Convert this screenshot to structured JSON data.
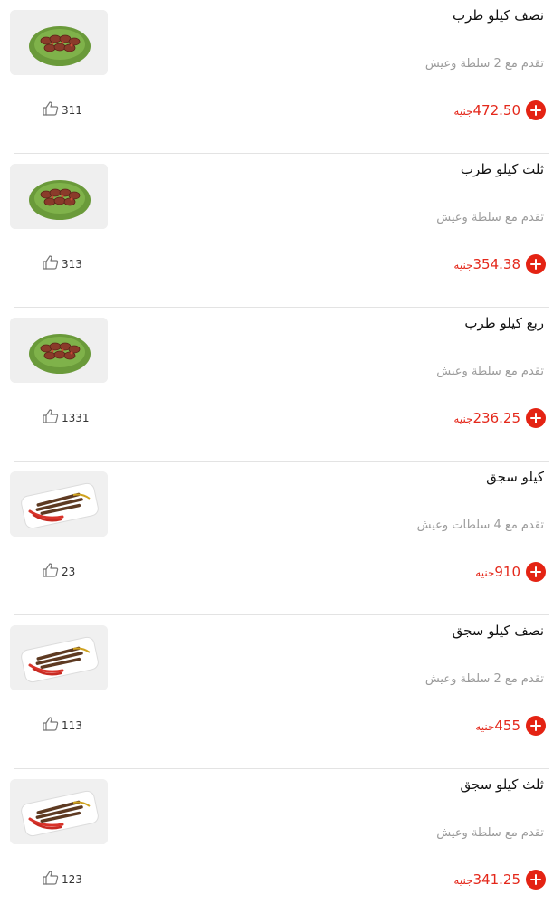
{
  "currency": "جنيه",
  "items": [
    {
      "name": "نصف كيلو طرب",
      "description": "تقدم مع 2 سلطة وعيش",
      "price": "472.50",
      "likes": "311",
      "image": "tarb-platter"
    },
    {
      "name": "ثلث كيلو طرب",
      "description": "تقدم مع سلطة وعيش",
      "price": "354.38",
      "likes": "313",
      "image": "tarb-platter"
    },
    {
      "name": "ربع كيلو طرب",
      "description": "تقدم مع سلطة وعيش",
      "price": "236.25",
      "likes": "1331",
      "image": "tarb-platter"
    },
    {
      "name": "كيلو سجق",
      "description": "تقدم مع 4 سلطات وعيش",
      "price": "910",
      "likes": "23",
      "image": "sausage-platter"
    },
    {
      "name": "نصف كيلو سجق",
      "description": "تقدم مع 2 سلطة وعيش",
      "price": "455",
      "likes": "113",
      "image": "sausage-platter"
    },
    {
      "name": "ثلث كيلو سجق",
      "description": "تقدم مع سلطة وعيش",
      "price": "341.25",
      "likes": "123",
      "image": "sausage-platter"
    }
  ],
  "icons": {
    "like": "thumbs-up-icon",
    "add": "add-icon"
  },
  "colors": {
    "price": "#e4281b",
    "add_button": "#e42313",
    "description": "#9b9b9b",
    "separator": "#e3e3e3"
  }
}
